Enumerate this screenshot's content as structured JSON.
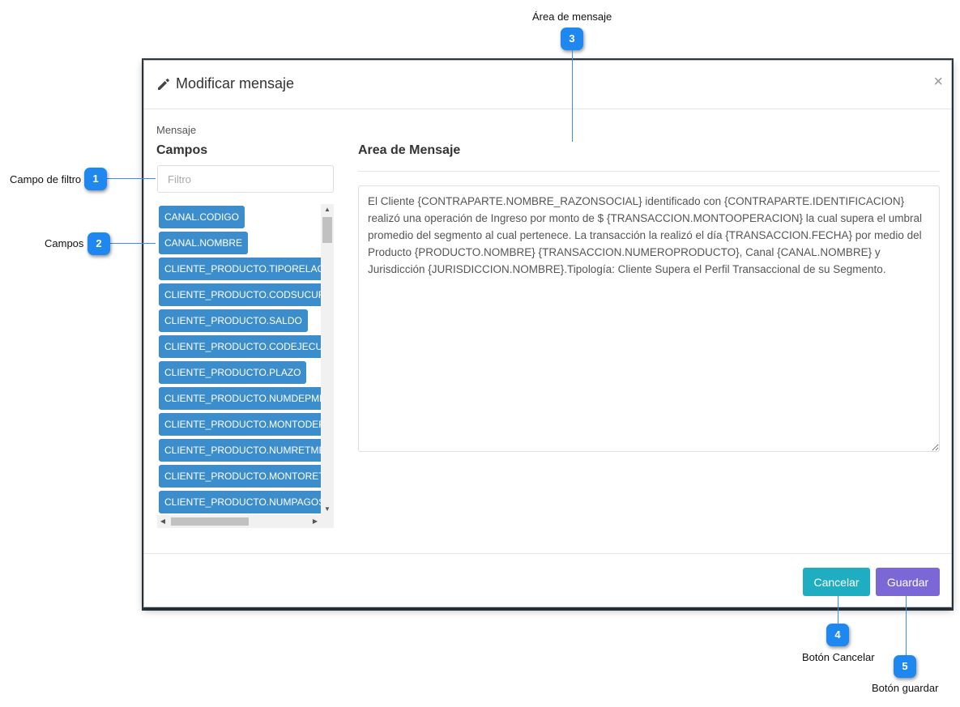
{
  "modal": {
    "title": "Modificar mensaje",
    "close_glyph": "×",
    "section_label": "Mensaje",
    "campos_title": "Campos",
    "filter_placeholder": "Filtro",
    "fields": [
      "CANAL.CODIGO",
      "CANAL.NOMBRE",
      "CLIENTE_PRODUCTO.TIPORELACION",
      "CLIENTE_PRODUCTO.CODSUCURSAL",
      "CLIENTE_PRODUCTO.SALDO",
      "CLIENTE_PRODUCTO.CODEJECUTIVO",
      "CLIENTE_PRODUCTO.PLAZO",
      "CLIENTE_PRODUCTO.NUMDEPMES",
      "CLIENTE_PRODUCTO.MONTODEPMES",
      "CLIENTE_PRODUCTO.NUMRETMES",
      "CLIENTE_PRODUCTO.MONTORETMES",
      "CLIENTE_PRODUCTO.NUMPAGOS"
    ],
    "area_title": "Area de Mensaje",
    "message": "El Cliente  {CONTRAPARTE.NOMBRE_RAZONSOCIAL} identificado con {CONTRAPARTE.IDENTIFICACION}  realizó una operación de Ingreso por monto de $ {TRANSACCION.MONTOOPERACION}  la cual supera el umbral promedio del segmento al cual pertenece. La transacción la realizó el día  {TRANSACCION.FECHA} por medio del Producto  {PRODUCTO.NOMBRE} {TRANSACCION.NUMEROPRODUCTO}, Canal  {CANAL.NOMBRE} y Jurisdicción {JURISDICCION.NOMBRE}.Tipología: Cliente Supera el Perfil Transaccional de su Segmento.",
    "cancel_label": "Cancelar",
    "save_label": "Guardar"
  },
  "callouts": {
    "c1": {
      "number": "1",
      "label": "Campo de filtro"
    },
    "c2": {
      "number": "2",
      "label": "Campos"
    },
    "c3": {
      "number": "3",
      "label": "Área de mensaje"
    },
    "c4": {
      "number": "4",
      "label": "Botón Cancelar"
    },
    "c5": {
      "number": "5",
      "label": "Botón guardar"
    }
  },
  "colors": {
    "tag_blue": "#3c8dcb",
    "cancel_teal": "#1fadc2",
    "save_purple": "#7b67d6",
    "badge_blue": "#1e88f0"
  }
}
